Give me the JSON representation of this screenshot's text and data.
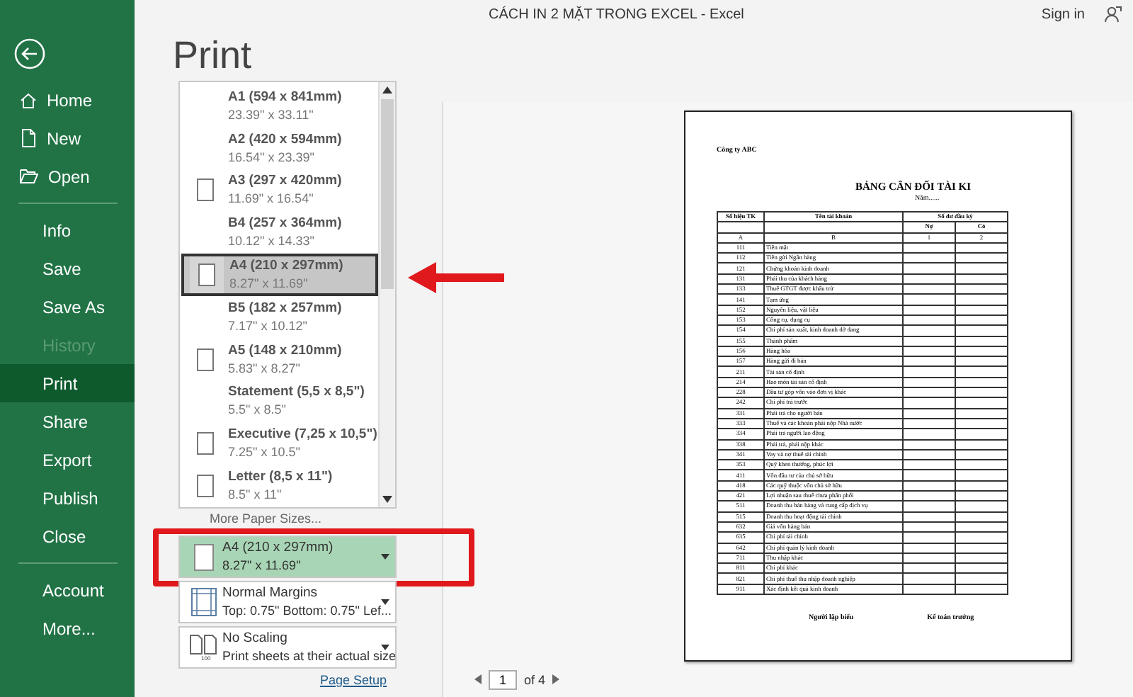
{
  "window": {
    "title": "CÁCH IN 2 MẶT TRONG EXCEL  -  Excel",
    "sign_in": "Sign in"
  },
  "sidebar": {
    "sections": [
      {
        "items": [
          {
            "label": "Home",
            "kind": "home",
            "selected": false,
            "disabled": false
          },
          {
            "label": "New",
            "kind": "new",
            "selected": false,
            "disabled": false
          },
          {
            "label": "Open",
            "kind": "open",
            "selected": false,
            "disabled": false
          }
        ]
      },
      {
        "items": [
          {
            "label": "Info",
            "kind": "plain",
            "selected": false,
            "disabled": false
          },
          {
            "label": "Save",
            "kind": "plain",
            "selected": false,
            "disabled": false
          },
          {
            "label": "Save As",
            "kind": "plain",
            "selected": false,
            "disabled": false
          },
          {
            "label": "History",
            "kind": "plain",
            "selected": false,
            "disabled": true
          },
          {
            "label": "Print",
            "kind": "plain",
            "selected": true,
            "disabled": false
          },
          {
            "label": "Share",
            "kind": "plain",
            "selected": false,
            "disabled": false
          },
          {
            "label": "Export",
            "kind": "plain",
            "selected": false,
            "disabled": false
          },
          {
            "label": "Publish",
            "kind": "plain",
            "selected": false,
            "disabled": false
          },
          {
            "label": "Close",
            "kind": "plain",
            "selected": false,
            "disabled": false
          }
        ]
      },
      {
        "items": [
          {
            "label": "Account",
            "kind": "plain",
            "selected": false,
            "disabled": false
          },
          {
            "label": "More...",
            "kind": "plain",
            "selected": false,
            "disabled": false
          }
        ]
      }
    ]
  },
  "heading": "Print",
  "paper_list": {
    "items": [
      {
        "name": "A1 (594 x 841mm)",
        "size": "23.39\" x 33.11\"",
        "icon": false,
        "selected": false
      },
      {
        "name": "A2 (420 x 594mm)",
        "size": "16.54\" x 23.39\"",
        "icon": false,
        "selected": false
      },
      {
        "name": "A3 (297 x 420mm)",
        "size": "11.69\" x 16.54\"",
        "icon": true,
        "selected": false
      },
      {
        "name": "B4 (257 x 364mm)",
        "size": "10.12\" x 14.33\"",
        "icon": false,
        "selected": false
      },
      {
        "name": "A4 (210 x 297mm)",
        "size": "8.27\" x 11.69\"",
        "icon": true,
        "selected": true
      },
      {
        "name": "B5 (182 x 257mm)",
        "size": "7.17\" x 10.12\"",
        "icon": false,
        "selected": false
      },
      {
        "name": "A5 (148 x 210mm)",
        "size": "5.83\" x 8.27\"",
        "icon": true,
        "selected": false
      },
      {
        "name": "Statement (5,5 x 8,5\")",
        "size": "5.5\" x 8.5\"",
        "icon": false,
        "selected": false
      },
      {
        "name": "Executive (7,25 x 10,5\")",
        "size": "7.25\" x 10.5\"",
        "icon": true,
        "selected": false
      },
      {
        "name": "Letter (8,5 x 11\")",
        "size": "8.5\" x 11\"",
        "icon": true,
        "selected": false
      }
    ],
    "more": "More Paper Sizes..."
  },
  "settings": [
    {
      "kind": "paper",
      "title": "A4 (210 x 297mm)",
      "detail": "8.27\" x 11.69\"",
      "expanded": true,
      "highlighted": true
    },
    {
      "kind": "margins",
      "title": "Normal Margins",
      "detail": "Top: 0.75\" Bottom: 0.75\" Lef...",
      "expanded": false,
      "highlighted": false
    },
    {
      "kind": "scaling",
      "title": "No Scaling",
      "detail": "Print sheets at their actual size",
      "expanded": false,
      "highlighted": false,
      "icon_text": "100"
    }
  ],
  "page_setup": "Page Setup",
  "preview": {
    "company": "Công ty ABC",
    "title": "BẢNG CÂN ĐỐI TÀI KI",
    "year": "Năm......",
    "headers": [
      "Số hiệu TK",
      "Tên tài khoản",
      "Số dư đầu kỳ"
    ],
    "subheaders": [
      "Nợ",
      "Có"
    ],
    "letters": [
      "A",
      "B",
      "1",
      "2"
    ],
    "rows": [
      {
        "code": "111",
        "name": "Tiền mặt"
      },
      {
        "code": "112",
        "name": "Tiền gửi Ngân hàng"
      },
      {
        "code": "121",
        "name": "Chứng khoán kinh doanh"
      },
      {
        "code": "131",
        "name": "Phải thu của khách hàng"
      },
      {
        "code": "133",
        "name": "Thuế GTGT được khấu trừ"
      },
      {
        "code": "141",
        "name": "Tạm ứng"
      },
      {
        "code": "152",
        "name": "Nguyên liệu, vật liệu"
      },
      {
        "code": "153",
        "name": "Công cụ, dụng cụ"
      },
      {
        "code": "154",
        "name": "Chi phí sản xuất, kinh doanh dở dang"
      },
      {
        "code": "155",
        "name": "Thành phẩm"
      },
      {
        "code": "156",
        "name": "Hàng hóa"
      },
      {
        "code": "157",
        "name": "Hàng gửi đi bán"
      },
      {
        "code": "211",
        "name": "Tài sản cố định"
      },
      {
        "code": "214",
        "name": "Hao mòn tài sản cố định"
      },
      {
        "code": "228",
        "name": "Đầu tư góp vốn vào đơn vị khác"
      },
      {
        "code": "242",
        "name": "Chi phí trả trước"
      },
      {
        "code": "331",
        "name": "Phải trả cho người bán"
      },
      {
        "code": "333",
        "name": "Thuế và các khoản phải nộp Nhà nước"
      },
      {
        "code": "334",
        "name": "Phải trả người lao động"
      },
      {
        "code": "338",
        "name": "Phải trả, phải nộp khác"
      },
      {
        "code": "341",
        "name": "Vay và nợ thuê tài chính"
      },
      {
        "code": "353",
        "name": "Quỹ khen thưởng, phúc lợi"
      },
      {
        "code": "411",
        "name": "Vốn đầu tư của chủ sở hữu"
      },
      {
        "code": "418",
        "name": "Các quỹ thuộc vốn chủ sở hữu"
      },
      {
        "code": "421",
        "name": "Lợi nhuận sau thuế chưa phân phối"
      },
      {
        "code": "511",
        "name": "Doanh thu bán hàng và cung cấp dịch vụ"
      },
      {
        "code": "515",
        "name": "Doanh thu hoạt động tài chính"
      },
      {
        "code": "632",
        "name": "Giá vốn hàng bán"
      },
      {
        "code": "635",
        "name": "Chi phí tài chính"
      },
      {
        "code": "642",
        "name": "Chi phí quản lý kinh doanh"
      },
      {
        "code": "711",
        "name": "Thu nhập khác"
      },
      {
        "code": "811",
        "name": "Chi phí khác"
      },
      {
        "code": "821",
        "name": "Chi phí thuế thu nhập doanh nghiệp"
      },
      {
        "code": "911",
        "name": "Xác định kết quả kinh doanh"
      }
    ],
    "signatures": [
      "Người lập biểu",
      "Kế toán trưởng"
    ]
  },
  "pager": {
    "page": "1",
    "of": "of 4"
  }
}
